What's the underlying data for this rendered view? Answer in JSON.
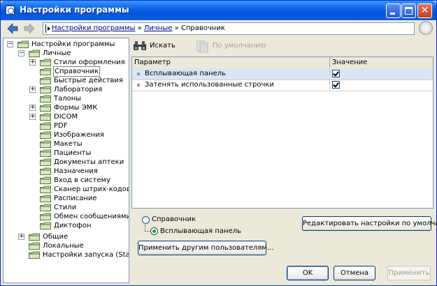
{
  "window": {
    "title": "Настройки программы"
  },
  "breadcrumb": {
    "items": [
      "Настройки программы",
      "Личные",
      "Справочник"
    ],
    "separator": "»"
  },
  "tree": {
    "root": "Настройки программы",
    "personal": "Личные",
    "personal_children": [
      "Стили оформления",
      "Справочник",
      "Быстрые действия",
      "Лаборатория",
      "Талоны",
      "Формы ЭМК",
      "DICOM",
      "PDF",
      "Изображения",
      "Макеты",
      "Пациенты",
      "Документы аптеки",
      "Назначения",
      "Вход в систему",
      "Сканер штрих-кодов",
      "Расписание",
      "Стили",
      "Обмен сообщениями",
      "Диктофон"
    ],
    "other": [
      "Общие",
      "Локальные",
      "Настройки запуска (StartUp)"
    ],
    "selected": "Справочник"
  },
  "toolbar": {
    "search_label": "Искать",
    "default_label": "По умолчанию"
  },
  "grid": {
    "columns": [
      "Параметр",
      "Значение"
    ],
    "rows": [
      {
        "param": "Всплывающая панель",
        "checked": true
      },
      {
        "param": "Затенять использованные строчки",
        "checked": true
      }
    ]
  },
  "options": {
    "radio_reference": "Справочник",
    "radio_popup": "Всплывающая панель",
    "selected": "Всплывающая панель"
  },
  "buttons": {
    "edit_defaults": "Редактировать настройки по умолчанию",
    "apply_others": "Применить другим пользователям...",
    "ok": "OK",
    "cancel": "Отмена",
    "apply": "Применить"
  },
  "colors": {
    "title_bar": "#0a5fe6",
    "selection": "#d8e6f8",
    "link": "#000080",
    "dialog_bg": "#ece9d8"
  }
}
